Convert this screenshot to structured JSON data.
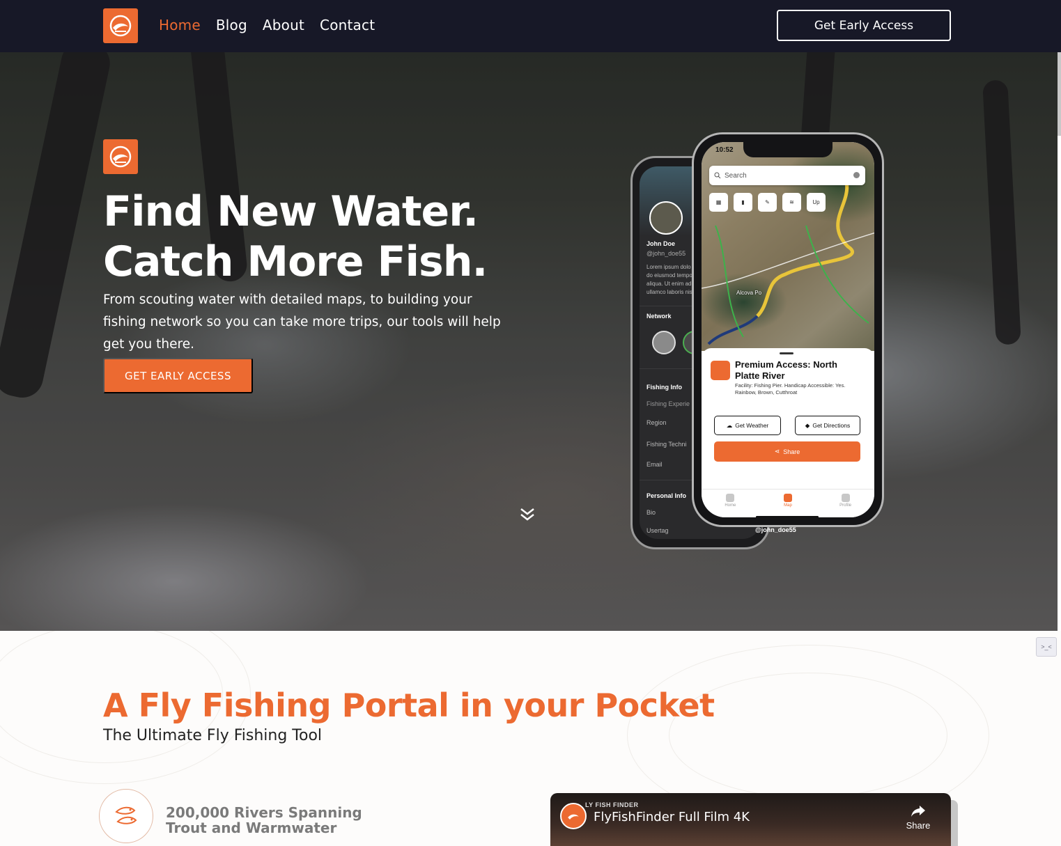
{
  "nav": {
    "links": [
      "Home",
      "Blog",
      "About",
      "Contact"
    ],
    "active_index": 0,
    "cta_label": "Get Early Access"
  },
  "hero": {
    "title_line1": "Find New Water.",
    "title_line2": "Catch More Fish.",
    "subtitle": "From scouting water with detailed maps, to building your fishing network so you can take more trips, our tools will help get you there.",
    "cta_label": "GET EARLY ACCESS"
  },
  "phone_profile": {
    "name": "John Doe",
    "handle": "@john_doe55",
    "bio_lines": [
      "Lorem ipsum dolo",
      "do eiusmod tempo",
      "aliqua. Ut enim ad",
      "ullamco laboris nis"
    ],
    "network_label": "Network",
    "fishing_info_label": "Fishing Info",
    "fishing_fields": [
      "Fishing Experie",
      "Region",
      "Fishing Techni",
      "Email"
    ],
    "personal_info_label": "Personal Info",
    "personal_fields": [
      "Bio",
      "Usertag"
    ],
    "usertag_value": "@john_doe55"
  },
  "phone_map": {
    "time": "10:52",
    "search_placeholder": "Search",
    "map_buttons": [
      "map-icon",
      "bookmark-icon",
      "pin-icon",
      "layers-icon",
      "Up"
    ],
    "place_label": "Alcova Po",
    "sheet": {
      "title": "Premium Access: North Platte River",
      "description": "Facility: Fishing Pier. Handicap Accessible: Yes. Rainbow, Brown, Cutthroat",
      "weather_label": "Get Weather",
      "directions_label": "Get Directions",
      "share_label": "Share"
    },
    "tabs": [
      "Home",
      "Map",
      "Profile"
    ],
    "active_tab": 1
  },
  "section": {
    "title": "A Fly Fishing Portal in your Pocket",
    "subtitle": "The Ultimate Fly Fishing Tool",
    "feature_line1": "200,000 Rivers Spanning",
    "feature_line2": "Trout and Warmwater"
  },
  "video": {
    "brand": "LY FISH FINDER",
    "title": "FlyFishFinder Full Film 4K",
    "share_label": "Share"
  },
  "side_widget_label": ">_<",
  "colors": {
    "accent": "#ec6a31",
    "nav_bg": "#171827"
  }
}
